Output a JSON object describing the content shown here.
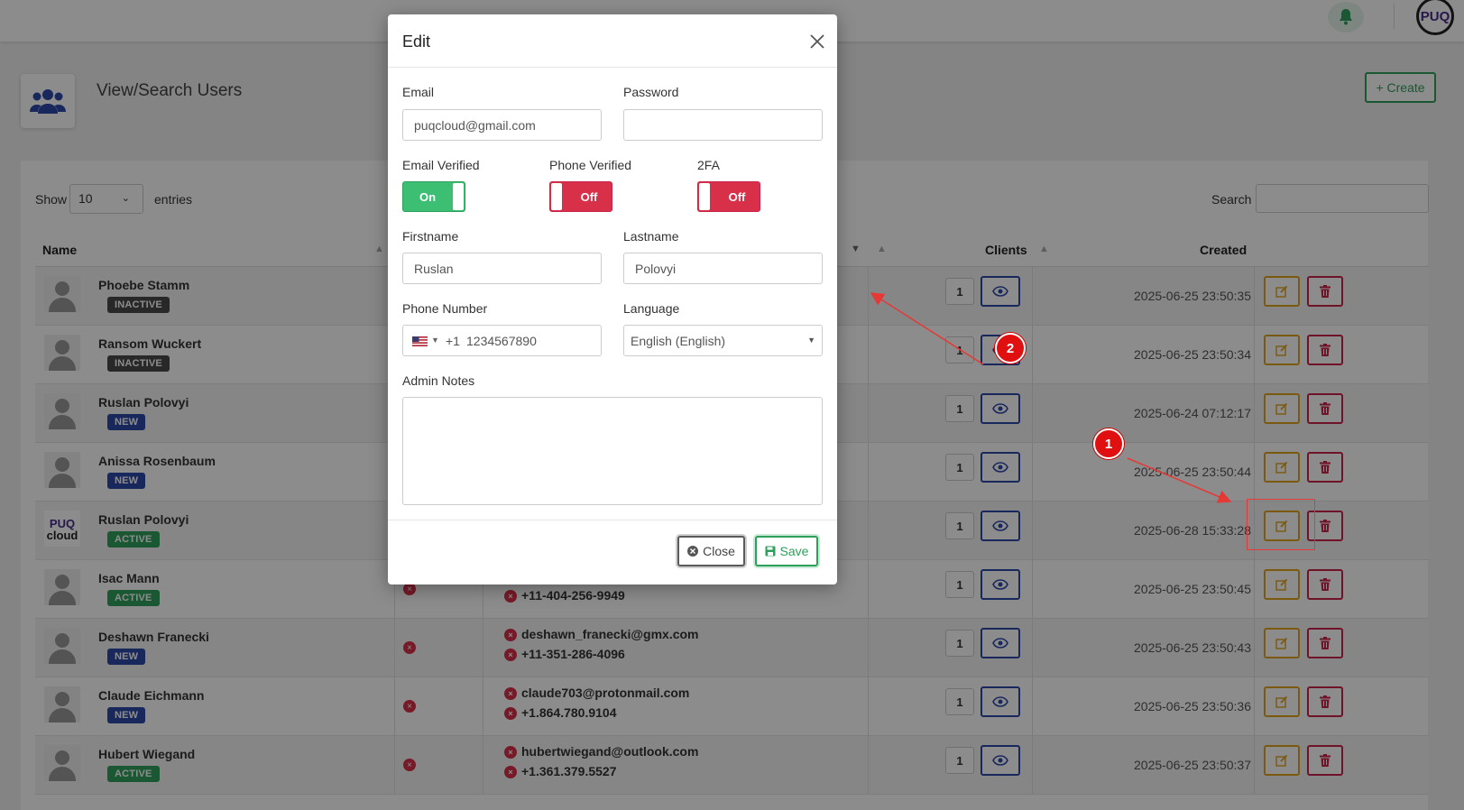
{
  "page": {
    "title": "View/Search Users",
    "create_label": "+ Create",
    "avatar_text": "PUQ"
  },
  "table_controls": {
    "show_label": "Show",
    "show_value": "10",
    "entries_label": "entries",
    "search_label": "Search"
  },
  "columns": {
    "name": "Name",
    "clients": "Clients",
    "created": "Created"
  },
  "rows": [
    {
      "name": "Phoebe Stamm",
      "status": "INACTIVE",
      "clients": "1",
      "created": "2025-06-25 23:50:35",
      "logo": false
    },
    {
      "name": "Ransom Wuckert",
      "status": "INACTIVE",
      "clients": "1",
      "created": "2025-06-25 23:50:34",
      "logo": false
    },
    {
      "name": "Ruslan Polovyi",
      "status": "NEW",
      "clients": "1",
      "created": "2025-06-24 07:12:17",
      "logo": false
    },
    {
      "name": "Anissa Rosenbaum",
      "status": "NEW",
      "clients": "1",
      "created": "2025-06-25 23:50:44",
      "logo": false
    },
    {
      "name": "Ruslan Polovyi",
      "status": "ACTIVE",
      "clients": "1",
      "created": "2025-06-28 15:33:28",
      "logo": true
    },
    {
      "name": "Isac Mann",
      "status": "ACTIVE",
      "clients": "1",
      "created": "2025-06-25 23:50:45",
      "logo": false,
      "phone": "+11-404-256-9949"
    },
    {
      "name": "Deshawn Franecki",
      "status": "NEW",
      "clients": "1",
      "created": "2025-06-25 23:50:43",
      "logo": false,
      "email": "deshawn_franecki@gmx.com",
      "phone": "+11-351-286-4096"
    },
    {
      "name": "Claude Eichmann",
      "status": "NEW",
      "clients": "1",
      "created": "2025-06-25 23:50:36",
      "logo": false,
      "email": "claude703@protonmail.com",
      "phone": "+1.864.780.9104"
    },
    {
      "name": "Hubert Wiegand",
      "status": "ACTIVE",
      "clients": "1",
      "created": "2025-06-25 23:50:37",
      "logo": false,
      "email": "hubertwiegand@outlook.com",
      "phone": "+1.361.379.5527"
    }
  ],
  "logo_text": {
    "top": "PUQ",
    "bottom": "cloud"
  },
  "modal": {
    "title": "Edit",
    "email_label": "Email",
    "email_value": "puqcloud@gmail.com",
    "password_label": "Password",
    "password_value": "",
    "email_verified_label": "Email Verified",
    "email_verified_state": "On",
    "phone_verified_label": "Phone Verified",
    "phone_verified_state": "Off",
    "twofa_label": "2FA",
    "twofa_state": "Off",
    "firstname_label": "Firstname",
    "firstname_value": "Ruslan",
    "lastname_label": "Lastname",
    "lastname_value": "Polovyi",
    "phone_label": "Phone Number",
    "phone_code": "+1",
    "phone_value": "1234567890",
    "language_label": "Language",
    "language_value": "English (English)",
    "notes_label": "Admin Notes",
    "notes_value": "",
    "close_label": "Close",
    "save_label": "Save"
  },
  "annotations": {
    "marker_1": "1",
    "marker_2": "2"
  },
  "colors": {
    "accent_green": "#2ea05b",
    "accent_blue": "#2f4aa8",
    "accent_red": "#d9304a",
    "accent_orange": "#e0a21b",
    "annotation_red": "#e01010"
  }
}
